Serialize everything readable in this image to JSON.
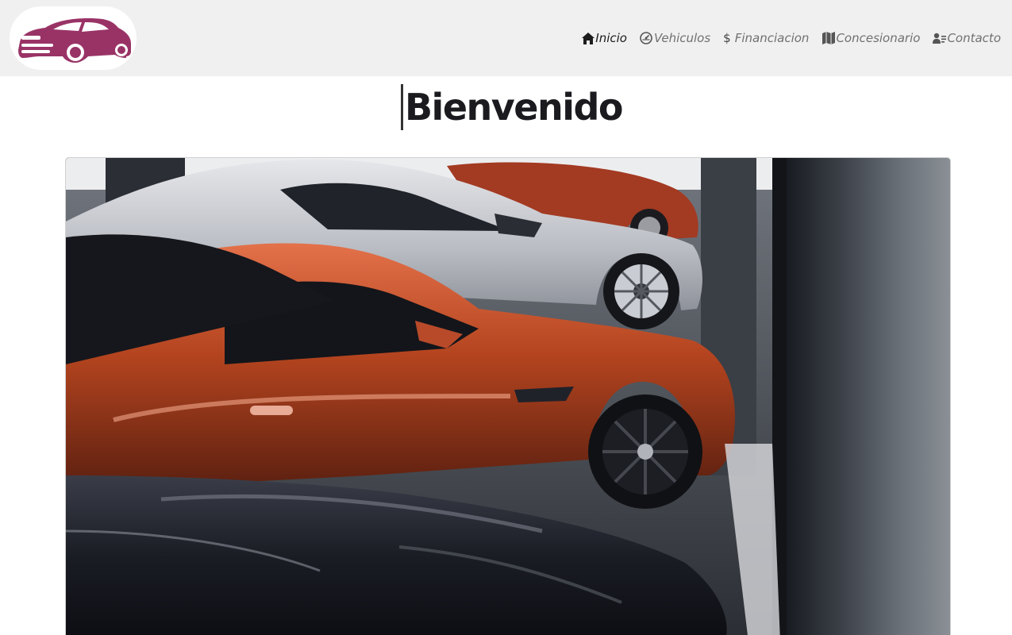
{
  "header": {
    "logo_icon": "car-icon",
    "nav": [
      {
        "label": "Inicio",
        "icon": "home-icon",
        "active": true
      },
      {
        "label": "Vehiculos",
        "icon": "speedometer-icon",
        "active": false
      },
      {
        "label": "Financiacion",
        "icon": "dollar-icon",
        "active": false
      },
      {
        "label": "Concesionario",
        "icon": "map-icon",
        "active": false
      },
      {
        "label": "Contacto",
        "icon": "contact-icon",
        "active": false
      }
    ]
  },
  "main": {
    "title": "Bienvenido",
    "hero_image": "sports-cars-showroom-photo"
  },
  "colors": {
    "brand": "#993366",
    "header_bg": "#f0f0f0",
    "nav_text": "#707070",
    "nav_active": "#1c1c1c",
    "title": "#1b1b1f"
  }
}
